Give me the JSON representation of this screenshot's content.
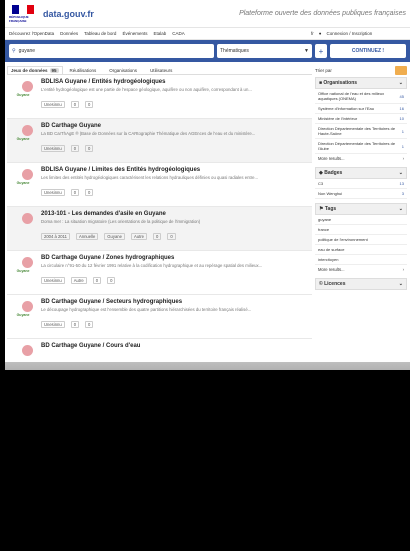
{
  "header": {
    "logo_text": "RÉPUBLIQUE FRANÇAISE",
    "site_name": "data.gouv.fr",
    "tagline": "Plateforme ouverte des données publiques françaises"
  },
  "nav": {
    "items": [
      "Découvrez l'OpenData",
      "Données",
      "Tableau de bord",
      "Événements",
      "Etalab",
      "CADA"
    ],
    "lang": "fr",
    "login": "Connexion / Inscription"
  },
  "search": {
    "value": "guyane",
    "select_value": "Thématiques",
    "button_label": "CONTINUEZ !"
  },
  "tabs": [
    {
      "label": "Jeux de données",
      "count": "95",
      "active": true
    },
    {
      "label": "Réutilisations",
      "count": "",
      "active": false
    },
    {
      "label": "Organisations",
      "count": "",
      "active": false
    },
    {
      "label": "Utilisateurs",
      "count": "",
      "active": false
    }
  ],
  "sort": {
    "label": "Trier par"
  },
  "results": [
    {
      "title": "BDLISA Guyane / Entités hydrogéologiques",
      "desc": "L'entité hydrogéologique est une partie de l'espace géologique, aquifère ou non aquifère, correspondant à un...",
      "thumb": "Guyane",
      "meta": [
        "Unesinnu",
        "0",
        "0"
      ]
    },
    {
      "title": "BD Carthage Guyane",
      "desc": "La BD CarThAgE ® (Base de Données sur la CARtographie Thématique des AGEnces de l'eau et du ministère...",
      "thumb": "Guyane",
      "meta": [
        "Unesinnu",
        "0",
        "0"
      ]
    },
    {
      "title": "BDLISA Guyane / Limites des Entités hydrogéologiques",
      "desc": "Les limites des entités hydrogéologiques caractérisent les relations hydrauliques définies ou quasi radiales entre...",
      "thumb": "Guyane",
      "meta": [
        "Unesinnu",
        "0",
        "0"
      ]
    },
    {
      "title": "2013-101 - Les demandes d'asile en Guyane",
      "desc": "Doma mer : La situation migratoire (Les orientations de la politique de l'immigration)",
      "thumb": "",
      "meta": [
        "2004 à 2011",
        "Annuelle",
        "Guyane",
        "Autre",
        "0",
        "0"
      ]
    },
    {
      "title": "BD Carthage Guyane / Zones hydrographiques",
      "desc": "La circulaire n°91-50 du 12 février 1991 relative à la codification hydrographique et au repérage spatial des milieux...",
      "thumb": "Guyane",
      "meta": [
        "Unesinnu",
        "Autre",
        "0",
        "0"
      ]
    },
    {
      "title": "BD Carthage Guyane / Secteurs hydrographiques",
      "desc": "Le découpage hydrographique est l'ensemble des quatre partitions hiérarchisées du territoire français réalisé...",
      "thumb": "Guyane",
      "meta": [
        "Unesinnu",
        "0",
        "0"
      ]
    },
    {
      "title": "BD Carthage Guyane / Cours d'eau",
      "desc": "",
      "thumb": "",
      "meta": []
    }
  ],
  "facets": {
    "organisations": {
      "title": "Organisations",
      "items": [
        {
          "label": "Office national de l'eau et des milieux aquatiques (ONEMA)",
          "count": "45"
        },
        {
          "label": "Système d'information sur l'Eau",
          "count": "16"
        },
        {
          "label": "Ministère de l'Intérieur",
          "count": "10"
        },
        {
          "label": "Direction Départementale des Territoires de Haute-Saône",
          "count": "1"
        },
        {
          "label": "Direction Départementale des Territoires de l'Aube",
          "count": "1"
        }
      ],
      "more": "More results..."
    },
    "badges": {
      "title": "Badges",
      "items": [
        {
          "label": "C3",
          "count": "13"
        },
        {
          "label": "Non Wenghui",
          "count": "3"
        }
      ]
    },
    "tags": {
      "title": "Tags",
      "items": [
        {
          "label": "guyane",
          "count": ""
        },
        {
          "label": "france",
          "count": ""
        },
        {
          "label": "politique de l'environnement",
          "count": ""
        },
        {
          "label": "eau de surface",
          "count": ""
        },
        {
          "label": "intercitoyen",
          "count": ""
        }
      ],
      "more": "More results..."
    },
    "licences": {
      "title": "Licences"
    }
  }
}
